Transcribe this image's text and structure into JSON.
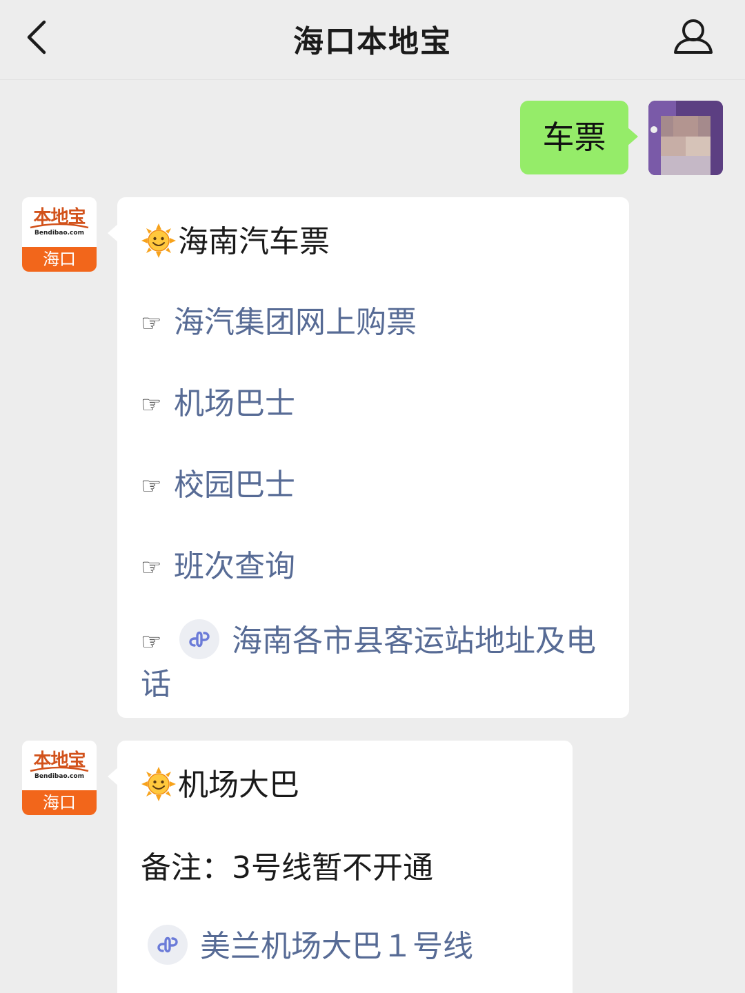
{
  "header": {
    "title": "海口本地宝",
    "back_icon": "chevron-left-icon",
    "profile_icon": "person-icon"
  },
  "user_message": {
    "text": "车票"
  },
  "bot": {
    "logo_name": "本地宝",
    "logo_url": "Bendibao.com",
    "logo_city": "海口"
  },
  "message1": {
    "title": "海南汽车票",
    "pointer": "☞",
    "links": [
      {
        "label": "海汽集团网上购票"
      },
      {
        "label": "机场巴士"
      },
      {
        "label": "校园巴士"
      },
      {
        "label": "班次查询"
      },
      {
        "label": "海南各市县客运站地址及电话"
      }
    ]
  },
  "message2": {
    "title": "机场大巴",
    "note": "备注：3号线暂不开通",
    "links": [
      {
        "label": "美兰机场大巴１号线"
      }
    ]
  },
  "colors": {
    "background": "#ededed",
    "my_bubble": "#95ec69",
    "link": "#576b95",
    "logo_orange": "#f2661b"
  }
}
